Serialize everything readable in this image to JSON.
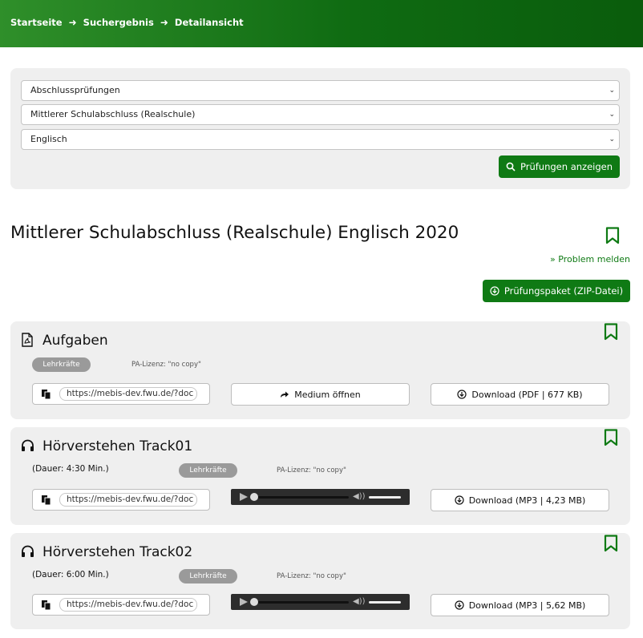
{
  "breadcrumb": {
    "home": "Startseite",
    "results": "Suchergebnis",
    "detail": "Detailansicht",
    "sep": "➜"
  },
  "filter": {
    "type": "Abschlussprüfungen",
    "level": "Mittlerer Schulabschluss (Realschule)",
    "subject": "Englisch",
    "submit": "Prüfungen anzeigen"
  },
  "page": {
    "title": "Mittlerer Schulabschluss (Realschule) Englisch 2020",
    "problem": "Problem melden",
    "zip": "Prüfungspaket (ZIP-Datei)"
  },
  "items": [
    {
      "title": "Aufgaben",
      "badge": "Lehrkräfte",
      "license": "PA-Lizenz: \"no copy\"",
      "url": "https://mebis-dev.fwu.de/?doc",
      "open": "Medium öffnen",
      "download": "Download (PDF | 677 KB)"
    },
    {
      "title": "Hörverstehen Track01",
      "duration": "(Dauer: 4:30 Min.)",
      "badge": "Lehrkräfte",
      "license": "PA-Lizenz: \"no copy\"",
      "url": "https://mebis-dev.fwu.de/?doc",
      "download": "Download (MP3 | 4,23 MB)"
    },
    {
      "title": "Hörverstehen Track02",
      "duration": "(Dauer: 6:00 Min.)",
      "badge": "Lehrkräfte",
      "license": "PA-Lizenz: \"no copy\"",
      "url": "https://mebis-dev.fwu.de/?doc",
      "download": "Download (MP3 | 5,62 MB)"
    }
  ],
  "colors": {
    "accent": "#0f7a14",
    "card": "#efefef",
    "badge": "#9a9a9a"
  },
  "icons": [
    "search-icon",
    "bookmark-icon",
    "double-chevron-icon",
    "download-circle-icon",
    "pdf-icon",
    "headphones-icon",
    "copy-icon",
    "share-arrow-icon",
    "play-icon",
    "volume-icon"
  ]
}
